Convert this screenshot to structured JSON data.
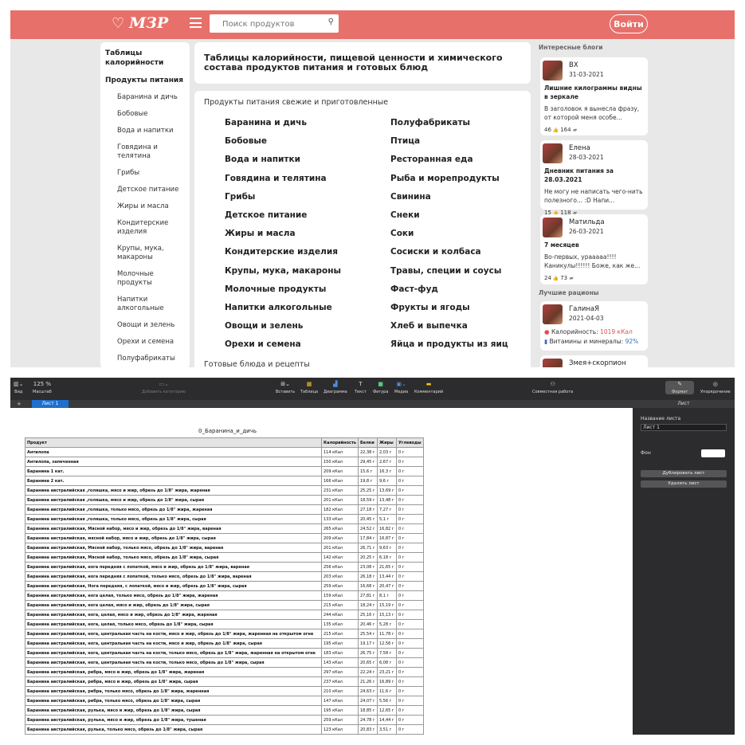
{
  "site": {
    "logo_text": "МЗР",
    "search_placeholder": "Поиск продуктов",
    "login_label": "Войти",
    "sidebar": {
      "heading1": "Таблицы калорийности",
      "heading2": "Продукты питания",
      "items": [
        "Баранина и дичь",
        "Бобовые",
        "Вода и напитки",
        "Говядина и телятина",
        "Грибы",
        "Детское питание",
        "Жиры и масла",
        "Кондитерские изделия",
        "Крупы, мука, макароны",
        "Молочные продукты",
        "Напитки алкогольные",
        "Овощи и зелень",
        "Орехи и семена",
        "Полуфабрикаты"
      ]
    },
    "main_title": "Таблицы калорийности, пищевой ценности и химического состава продуктов питания и готовых блюд",
    "products_label": "Продукты питания свежие и приготовленные",
    "products_left": [
      "Баранина и дичь",
      "Бобовые",
      "Вода и напитки",
      "Говядина и телятина",
      "Грибы",
      "Детское питание",
      "Жиры и масла",
      "Кондитерские изделия",
      "Крупы, мука, макароны",
      "Молочные продукты",
      "Напитки алкогольные",
      "Овощи и зелень",
      "Орехи и семена"
    ],
    "products_right": [
      "Полуфабрикаты",
      "Птица",
      "Ресторанная еда",
      "Рыба и морепродукты",
      "Свинина",
      "Снеки",
      "Соки",
      "Сосиски и колбаса",
      "Травы, специи и соусы",
      "Фаст-фуд",
      "Фрукты и ягоды",
      "Хлеб и выпечка",
      "Яйца и продукты из яиц"
    ],
    "ready_label": "Готовые блюда и рецепты",
    "blogs_heading": "Интересные блоги",
    "blogs": [
      {
        "author": "ВХ",
        "date": "31-03-2021",
        "title": "Лишние килограммы видны в зеркале",
        "text": "В заголовок я вынесла фразу, от которой меня особе...",
        "likes": "46",
        "comments": "164"
      },
      {
        "author": "Елена",
        "date": "28-03-2021",
        "title": "Дневник питания за 28.03.2021",
        "text": "Не могу не написать чего-нить полезного... :D Напи...",
        "likes": "15",
        "comments": "118"
      },
      {
        "author": "Матильда",
        "date": "26-03-2021",
        "title": "7 месяцев",
        "text": "Во-первых, урааааа!!!! Каникулы!!!!!! Боже, как же...",
        "likes": "24",
        "comments": "73"
      }
    ],
    "rations_heading": "Лучшие рационы",
    "ration": {
      "author": "ГалинаЯ",
      "date": "2021-04-03",
      "cal_label": "Калорийность:",
      "cal_value": "1019 кКал",
      "vit_label": "Витамины и минералы:",
      "vit_value": "92%"
    },
    "ration2_author": "Змея+скорпион",
    "colors": {
      "brand": "#e8706a",
      "background": "#e8e8e8"
    }
  },
  "numbers": {
    "toolbar": {
      "view_label": "Вид",
      "zoom_value": "125 %",
      "zoom_label": "Масштаб",
      "categories_label": "Добавить категорию",
      "insert_label": "Вставить",
      "table_label": "Таблица",
      "chart_label": "Диаграмма",
      "text_label": "Текст",
      "shape_label": "Фигура",
      "media_label": "Медиа",
      "comment_label": "Комментарий",
      "collab_label": "Совместная работа",
      "format_label": "Формат",
      "arrange_label": "Упорядочение"
    },
    "sheet_tab": "Лист 1",
    "panel": {
      "header": "Лист",
      "name_label": "Название листа",
      "name_value": "Лист 1",
      "bg_label": "Фон",
      "dup_button": "Дублировать лист",
      "del_button": "Удалить лист"
    },
    "sheet_title": "0_Баранина_и_дичь",
    "columns": [
      "Продукт",
      "Калорийность",
      "Белки",
      "Жиры",
      "Углеводы"
    ],
    "rows": [
      [
        "Антилопа",
        "114 кКал",
        "22,38 г",
        "2,03 г",
        "0 г"
      ],
      [
        "Антилопа, запеченная",
        "150 кКал",
        "29,45 г",
        "2,67 г",
        "0 г"
      ],
      [
        "Баранина 1 кат.",
        "209 кКал",
        "15,6 г",
        "16,3 г",
        "0 г"
      ],
      [
        "Баранина 2 кат.",
        "166 кКал",
        "19,8 г",
        "9,6 г",
        "0 г"
      ],
      [
        "Баранина австралийская ,голяшка, мясо и жир, обрезь до 1/8\" жира, жареная",
        "231 кКал",
        "25,25 г",
        "13,69 г",
        "0 г"
      ],
      [
        "Баранина австралийская ,голяшка, мясо и жир, обрезь до 1/8\" жира, сырая",
        "201 кКал",
        "18,59 г",
        "13,48 г",
        "0 г"
      ],
      [
        "Баранина австралийская ,голяшка, только мясо, обрезь до 1/8\" жира, жареная",
        "182 кКал",
        "27,18 г",
        "7,27 г",
        "0 г"
      ],
      [
        "Баранина австралийская ,голяшка, только мясо, обрезь до 1/8\" жира, сырая",
        "133 кКал",
        "20,45 г",
        "5,1 г",
        "0 г"
      ],
      [
        "Баранина австралийская, Мясной набор, мясо и жир, обрезь до 1/8\" жира, вареная",
        "265 кКал",
        "24,52 г",
        "16,82 г",
        "0 г"
      ],
      [
        "Баранина австралийская, мясной набор, мясо и жир, обрезь до 1/8\" жира, сырая",
        "209 кКал",
        "17,84 г",
        "16,87 г",
        "0 г"
      ],
      [
        "Баранина австралийская, Мясной набор, только мясо, обрезь до 1/8\" жира, вареная",
        "201 кКал",
        "26,71 г",
        "9,63 г",
        "0 г"
      ],
      [
        "Баранина австралийская, Мясной набор, только мясо, обрезь до 1/8\" жира, сырая",
        "142 кКал",
        "20,25 г",
        "6,18 г",
        "0 г"
      ],
      [
        "Баранина австралийская, нога передняя с лопаткой, мясо и жир, обрезь до 1/8\" жира, вареная",
        "256 кКал",
        "23,08 г",
        "21,65 г",
        "0 г"
      ],
      [
        "Баранина австралийская, нога передняя с лопаткой, только мясо, обрезь до 1/8\" жира, вареная",
        "203 кКал",
        "26,18 г",
        "13,44 г",
        "0 г"
      ],
      [
        "Баранина австралийская, Нога передняя, с лопаткой, мясо и жир, обрезь до 1/8\" жира, сырая",
        "259 кКал",
        "16,68 г",
        "20,47 г",
        "0 г"
      ],
      [
        "Баранина австралийская, нога целая, только мясо, обрезь до 1/8\" жира, жареная",
        "159 кКал",
        "27,81 г",
        "8,1 г",
        "0 г"
      ],
      [
        "Баранина австралийская, нога целая, мясо и жир, обрезь до 1/8\" жира, сырая",
        "215 кКал",
        "18,24 г",
        "15,19 г",
        "0 г"
      ],
      [
        "Баранина австралийская, нога, целая, мясо и жир, обрезь до 1/8\" жира, жареная",
        "244 кКал",
        "25,16 г",
        "15,13 г",
        "0 г"
      ],
      [
        "Баранина австралийская, нога, целая, только мясо, обрезь до 1/8\" жира, сырая",
        "135 кКал",
        "20,46 г",
        "5,28 г",
        "0 г"
      ],
      [
        "Баранина австралийская, нога, центральная часть на кости, мясо и жир, обрезь до 1/8\" жира, жаренная на открытом огне",
        "215 кКал",
        "25,54 г",
        "11,78 г",
        "0 г"
      ],
      [
        "Баранина австралийская, нога, центральная часть на кости, мясо и жир, обрезь до 1/8\" жира, сырая",
        "195 кКал",
        "19,17 г",
        "12,56 г",
        "0 г"
      ],
      [
        "Баранина австралийская, нога, центральная часть на кости, только мясо, обрезь до 1/8\" жира, жаренная на открытом огне",
        "183 кКал",
        "26,75 г",
        "7,58 г",
        "0 г"
      ],
      [
        "Баранина австралийская, нога, центральная часть на кости, только мясо, обрезь до 1/8\" жира, сырая",
        "143 кКал",
        "20,65 г",
        "6,08 г",
        "0 г"
      ],
      [
        "Баранина австралийская, ребра, мясо и жир, обрезь до 1/8\" жира, жареная",
        "297 кКал",
        "22,24 г",
        "23,21 г",
        "0 г"
      ],
      [
        "Баранина австралийская, ребра, мясо и жир, обрезь до 1/8\" жира, сырая",
        "237 кКал",
        "21,26 г",
        "16,89 г",
        "0 г"
      ],
      [
        "Баранина австралийская, ребра, только мясо, обрезь до 1/8\" жира, жаренная",
        "210 кКал",
        "24,63 г",
        "11,6 г",
        "0 г"
      ],
      [
        "Баранина австралийская, ребра, только мясо, обрезь до 1/8\" жира, сырая",
        "147 кКал",
        "24,07 г",
        "5,56 г",
        "0 г"
      ],
      [
        "Баранина австралийская, рулька, мясо и жир, обрезь до 1/8\" жира, сырая",
        "195 кКал",
        "18,85 г",
        "12,65 г",
        "0 г"
      ],
      [
        "Баранина австралийская, рулька, мясо и жир, обрезь до 1/8\" жира, тушеная",
        "259 кКал",
        "24,78 г",
        "14,44 г",
        "0 г"
      ],
      [
        "Баранина австралийская, рулька, только мясо, обрезь до 1/8\" жира, сырая",
        "123 кКал",
        "20,83 г",
        "3,51 г",
        "0 г"
      ]
    ]
  }
}
